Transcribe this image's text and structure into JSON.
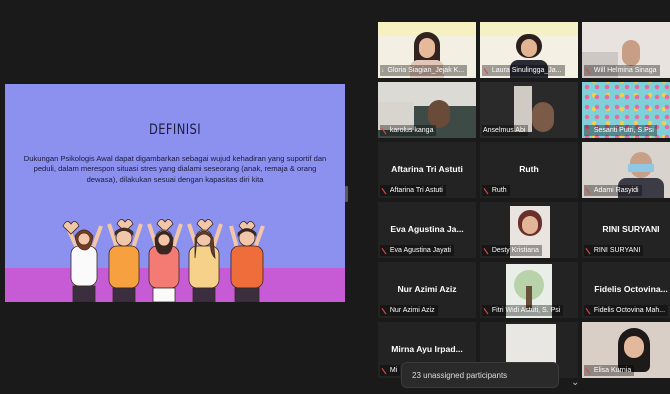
{
  "slide": {
    "title": "DEFINISI",
    "body": "Dukungan Psikologis Awal dapat digambarkan sebagai wujud kehadiran yang suportif dan peduli, dalam merespon situasi stres yang dialami seseorang (anak, remaja & orang dewasa), dilakukan sesuai dengan kapasitas diri kita"
  },
  "participants": [
    {
      "label": "Gloria Siagian_Jejak K...",
      "pinned": true,
      "active": true,
      "muted": false,
      "display": ""
    },
    {
      "label": "Laura Sinulingga_Ja...",
      "pinned": false,
      "muted": true,
      "display": ""
    },
    {
      "label": "Will Helmina Sinaga",
      "pinned": false,
      "muted": true,
      "display": ""
    },
    {
      "label": "karolus kanga",
      "pinned": false,
      "muted": true,
      "display": ""
    },
    {
      "label": "Anselmus Abi",
      "pinned": false,
      "muted": false,
      "display": ""
    },
    {
      "label": "Sesanti Putri, S.Psi",
      "pinned": false,
      "muted": true,
      "display": ""
    },
    {
      "label": "Aftarina Tri Astuti",
      "pinned": false,
      "muted": true,
      "display": "Aftarina Tri Astuti"
    },
    {
      "label": "Ruth",
      "pinned": false,
      "muted": true,
      "display": "Ruth"
    },
    {
      "label": "Adami Rasyidi",
      "pinned": false,
      "muted": true,
      "display": ""
    },
    {
      "label": "Eva Agustina Jayati",
      "pinned": false,
      "muted": true,
      "display": "Eva Agustina Ja..."
    },
    {
      "label": "Desty Kristiana",
      "pinned": false,
      "muted": true,
      "display": ""
    },
    {
      "label": "RINI SURYANI",
      "pinned": false,
      "muted": true,
      "display": "RINI SURYANI"
    },
    {
      "label": "Nur Azimi Aziz",
      "pinned": false,
      "muted": true,
      "display": "Nur Azimi Aziz"
    },
    {
      "label": "Fitri Widi Astuti, S. Psi",
      "pinned": false,
      "muted": true,
      "display": ""
    },
    {
      "label": "Fidelis Octovina Mah...",
      "pinned": false,
      "muted": true,
      "display": "Fidelis Octovina..."
    },
    {
      "label": "Mi",
      "pinned": false,
      "muted": true,
      "display": "Mirna Ayu Irpad..."
    },
    {
      "label": "",
      "pinned": false,
      "muted": false,
      "display": ""
    },
    {
      "label": "Elisa Kurnia",
      "pinned": false,
      "muted": true,
      "display": ""
    }
  ],
  "unassigned": "23 unassigned participants",
  "icons": {
    "mic_muted": "mic-off-icon",
    "pin": "pin-icon",
    "expand": "chevron-down-icon"
  },
  "colors": {
    "slide_bg": "#8c90ee",
    "slide_band": "#c75bd6",
    "active_speaker": "#d7cf4c",
    "muted": "#e24646"
  }
}
